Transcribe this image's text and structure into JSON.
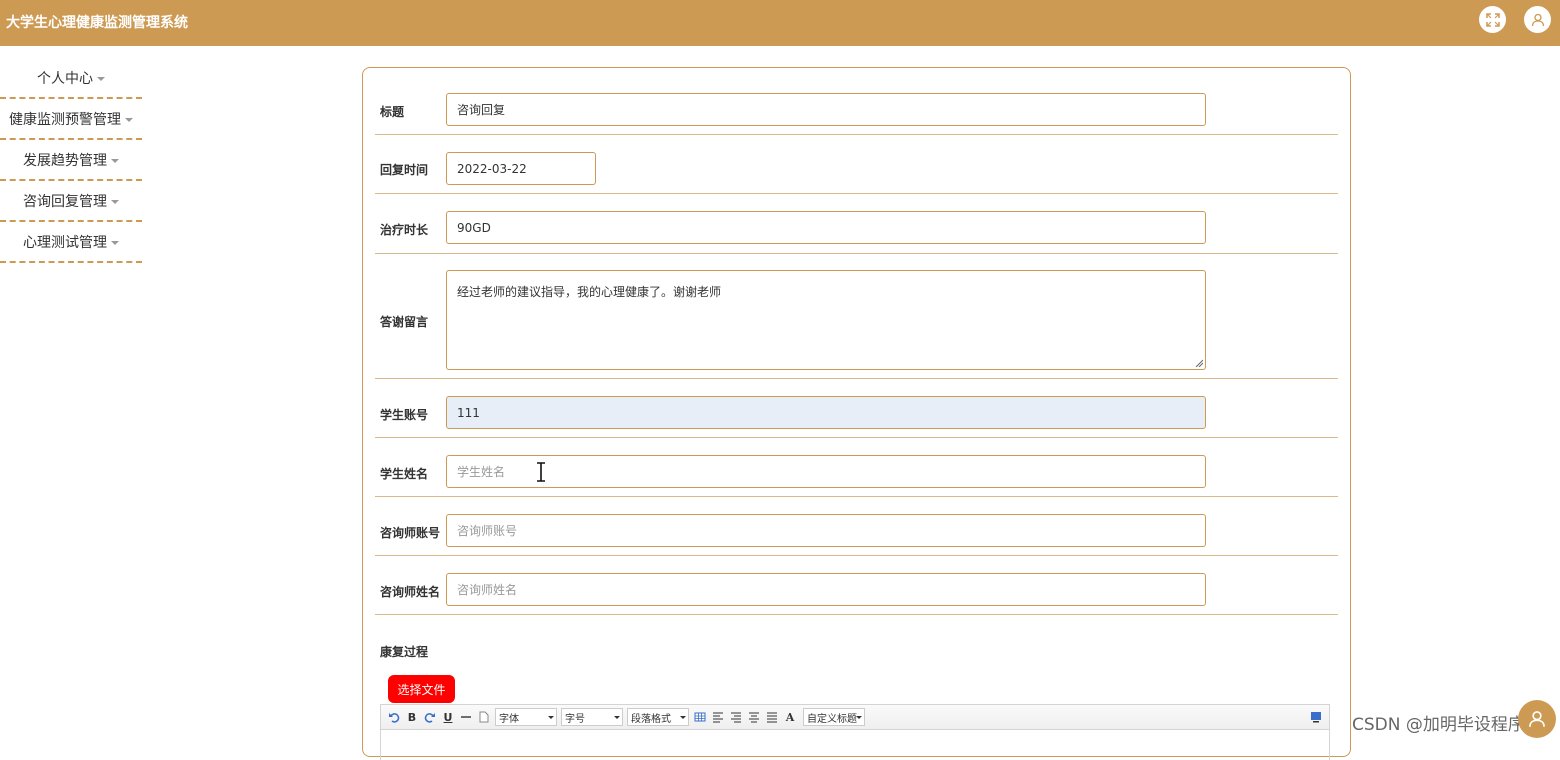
{
  "header": {
    "app_title": "大学生心理健康监测管理系统",
    "icons": [
      "fullscreen-icon",
      "user-icon"
    ]
  },
  "sidebar": {
    "items": [
      {
        "label": "个人中心"
      },
      {
        "label": "健康监测预警管理"
      },
      {
        "label": "发展趋势管理"
      },
      {
        "label": "咨询回复管理"
      },
      {
        "label": "心理测试管理"
      }
    ]
  },
  "form": {
    "title": {
      "label": "标题",
      "value": "咨询回复"
    },
    "reply_time": {
      "label": "回复时间",
      "value": "2022-03-22"
    },
    "treatment_duration": {
      "label": "治疗时长",
      "value": "90GD"
    },
    "thanks_message": {
      "label": "答谢留言",
      "value": "经过老师的建议指导，我的心理健康了。谢谢老师"
    },
    "student_account": {
      "label": "学生账号",
      "value": "111"
    },
    "student_name": {
      "label": "学生姓名",
      "placeholder": "学生姓名"
    },
    "counselor_account": {
      "label": "咨询师账号",
      "placeholder": "咨询师账号"
    },
    "counselor_name": {
      "label": "咨询师姓名",
      "placeholder": "咨询师姓名"
    },
    "recovery_process": {
      "label": "康复过程"
    },
    "choose_file": "选择文件"
  },
  "editor": {
    "font": "字体",
    "size": "字号",
    "paragraph": "段落格式",
    "custom_title": "自定义标题",
    "bold": "B",
    "underline": "U",
    "font_color": "A"
  },
  "watermark": "CSDN @加明毕设程序",
  "colors": {
    "accent": "#cd9a54",
    "danger": "#ff0000",
    "readonly_bg": "#e8eef8"
  }
}
